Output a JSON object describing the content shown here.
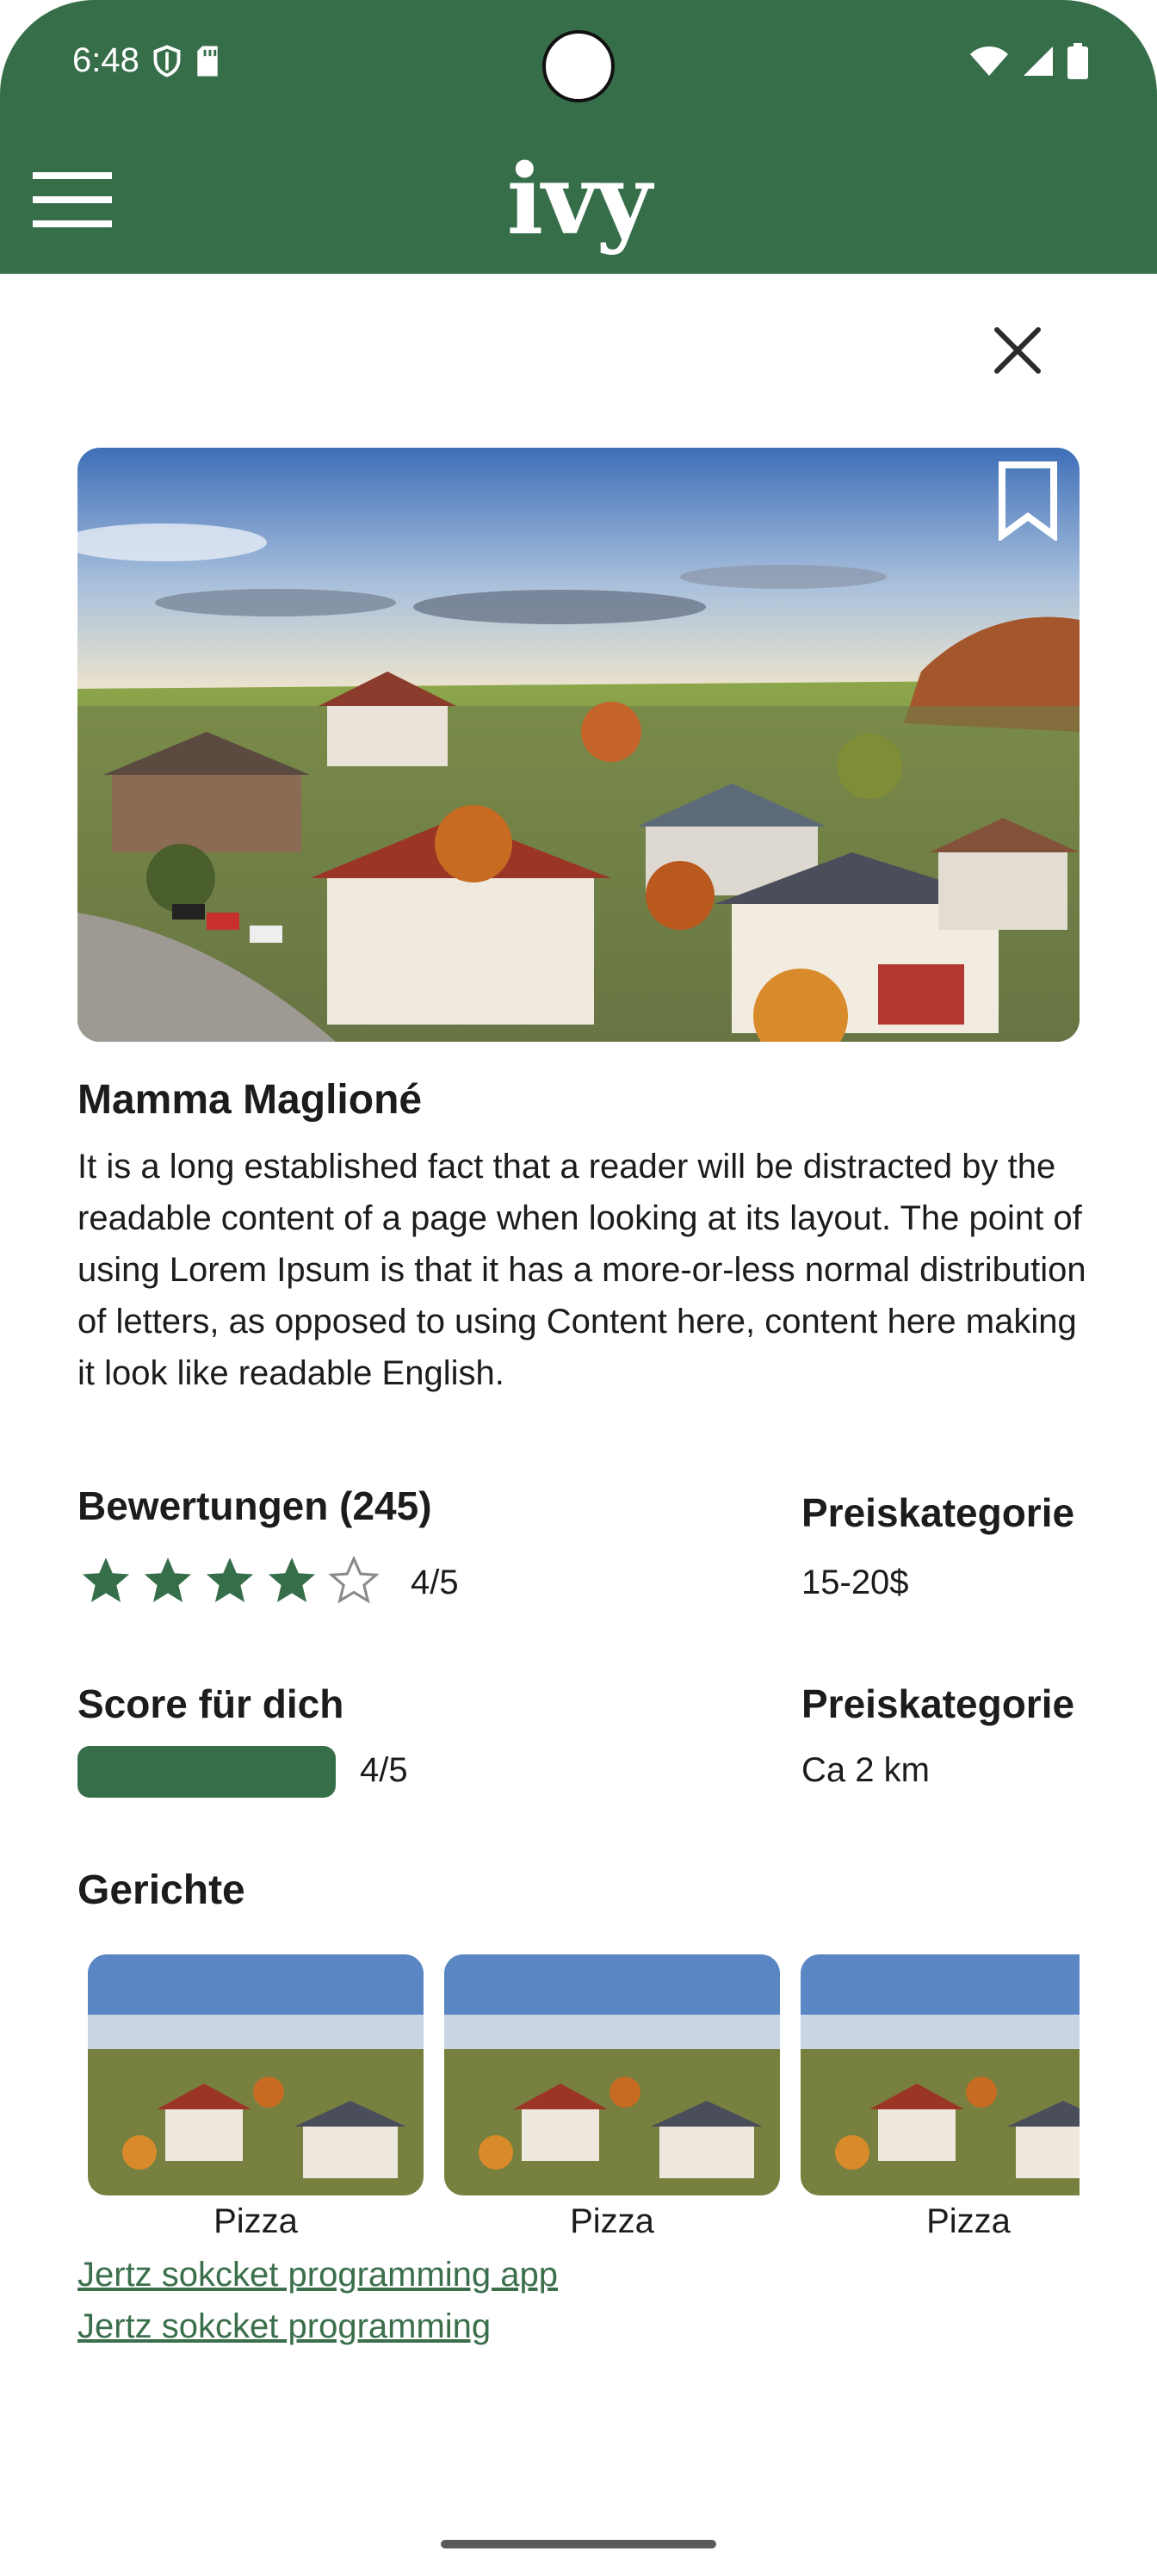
{
  "status": {
    "time": "6:48"
  },
  "app": {
    "logo": "ivy"
  },
  "restaurant": {
    "name": "Mamma Maglioné",
    "description": "It is a long established fact that a reader will be distracted by the readable content of a page when looking at its layout. The point of using Lorem Ipsum is that it has a more-or-less normal distribution of letters, as opposed to using Content here, content here making it look like readable English."
  },
  "ratings": {
    "label": "Bewertungen (245)",
    "stars_filled": 4,
    "stars_total": 5,
    "value": "4/5"
  },
  "price": {
    "label": "Preiskategorie",
    "value": "15-20$"
  },
  "score": {
    "label": "Score für dich",
    "value": "4/5",
    "level": 0.8
  },
  "distance": {
    "label": "Preiskategorie",
    "value": "Ca 2 km"
  },
  "dishes": {
    "title": "Gerichte",
    "items": [
      {
        "name": "Pizza"
      },
      {
        "name": "Pizza"
      },
      {
        "name": "Pizza"
      }
    ]
  },
  "links": [
    "Jertz sokcket programming app",
    "Jertz sokcket programming"
  ],
  "colors": {
    "brand": "#376e4a",
    "link": "#3b6f4c"
  },
  "icons": [
    "menu-icon",
    "close-icon",
    "bookmark-icon",
    "star-icon",
    "wifi-icon",
    "signal-icon",
    "battery-icon",
    "shield-icon",
    "sd-card-icon"
  ]
}
